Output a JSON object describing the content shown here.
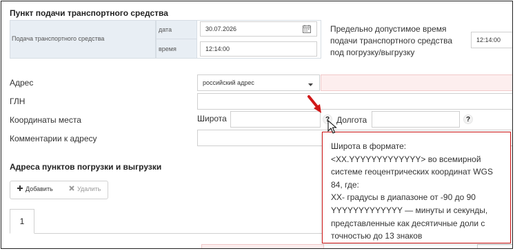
{
  "section_point": {
    "title": "Пункт подачи транспортного средства",
    "row_label": "Подача транспортного средства",
    "date_label": "дата",
    "date_value": "30.07.2026",
    "time_label": "время",
    "time_value": "12:14:00",
    "max_time_label": "Предельно допустимое время подачи транспортного средства под погрузку/выгрузку",
    "max_time_value": "12:14:00"
  },
  "address": {
    "label": "Адрес",
    "type_value": "российский адрес",
    "gln_label": "ГЛН",
    "coords_label": "Координаты места",
    "lat_label": "Широта",
    "lon_label": "Долгота",
    "comments_label": "Комментарии к адресу",
    "help_glyph": "?"
  },
  "loading_points": {
    "title": "Адреса пунктов погрузки и выгрузки",
    "add_label": "Добавить",
    "delete_label": "Удалить",
    "tab_label": "1"
  },
  "tooltip": {
    "line1": "Широта в формате:",
    "line2": "<XX.YYYYYYYYYYYYY> во всемирной системе геоцентрических координат WGS 84, где:",
    "line3": "XX- градусы в диапазоне от -90 до 90 YYYYYYYYYYYYY — минуты и секунды, представленные как десятичные доли с точностью до 13 знаков"
  },
  "colors": {
    "accent_red": "#d01818",
    "required_pink": "#fdeeee",
    "header_cell_gray": "#e8eef4"
  },
  "icons": [
    "calendar-icon",
    "chevron-down-icon",
    "plus-icon",
    "close-icon",
    "red-arrow-icon",
    "mouse-cursor-icon",
    "help-icon"
  ]
}
